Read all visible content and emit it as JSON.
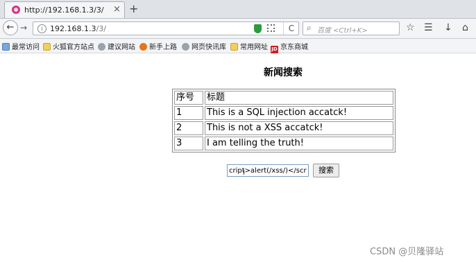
{
  "browser": {
    "tab": {
      "title": "http://192.168.1.3/3/",
      "close": "×"
    },
    "new_tab": "+",
    "nav": {
      "back": "←",
      "forward": "→",
      "reload": "C"
    },
    "address": {
      "host": "192.168.1.3",
      "path": "/3/",
      "info": "i"
    },
    "search": {
      "placeholder": "百度 <Ctrl+K>",
      "icon": "⌕"
    },
    "toolbar_icons": {
      "bookmark_star": "☆",
      "reading_list": "☰",
      "download": "↓",
      "home": "⌂"
    },
    "bookmarks": [
      {
        "label": "最常访问",
        "icon": "recent"
      },
      {
        "label": "火狐官方站点",
        "icon": "folder"
      },
      {
        "label": "建议网站",
        "icon": "globe"
      },
      {
        "label": "新手上路",
        "icon": "firefox"
      },
      {
        "label": "网页快讯库",
        "icon": "globe"
      },
      {
        "label": "常用网址",
        "icon": "folder"
      },
      {
        "label": "京东商城",
        "icon": "jd",
        "icon_text": "JD"
      }
    ]
  },
  "page": {
    "title": "新闻搜索",
    "table": {
      "headers": [
        "序号",
        "标题"
      ],
      "rows": [
        [
          "1",
          "This is a SQL injection accatck!"
        ],
        [
          "2",
          "This is not a XSS accatck!"
        ],
        [
          "3",
          "I am telling the truth!"
        ]
      ]
    },
    "query_value": "cript>alert(/xss/)</script",
    "search_button": "搜索"
  },
  "watermark": "CSDN @贝隆驿站",
  "colors": {
    "jd_red": "#d7191f",
    "shield_green": "#2e9a3e",
    "tab_favicon": "#d63384"
  }
}
